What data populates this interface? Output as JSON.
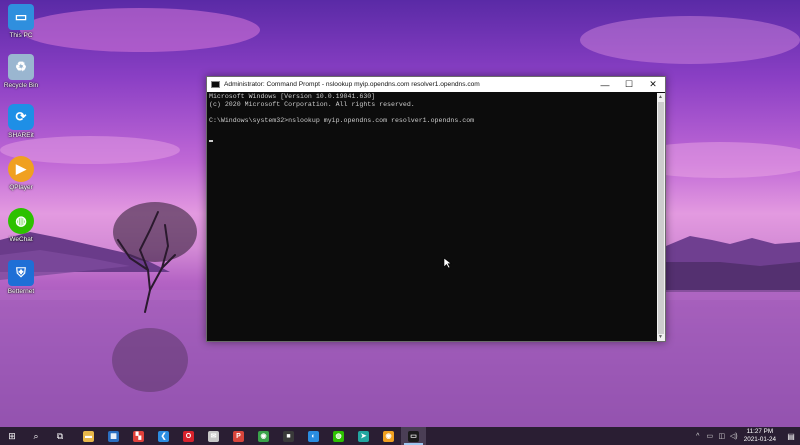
{
  "desktop": {
    "icons": [
      {
        "label": "This PC",
        "icon": "computer-icon",
        "color": "#2f8fde"
      },
      {
        "label": "Recycle Bin",
        "icon": "recycle-bin-icon",
        "color": "#9ab6d0"
      },
      {
        "label": "SHAREit",
        "icon": "shareit-icon",
        "color": "#1e8fe6"
      },
      {
        "label": "QPlayer",
        "icon": "qplayer-icon",
        "color": "#f0a020"
      },
      {
        "label": "WeChat",
        "icon": "wechat-icon",
        "color": "#2dc100"
      },
      {
        "label": "Betternet",
        "icon": "betternet-icon",
        "color": "#1f6fd6"
      }
    ]
  },
  "window": {
    "title": "Administrator: Command Prompt - nslookup  myip.opendns.com resolver1.opendns.com",
    "buttons": {
      "minimize": "—",
      "maximize": "☐",
      "close": "✕"
    },
    "console_lines": [
      "Microsoft Windows [Version 10.0.19041.630]",
      "(c) 2020 Microsoft Corporation. All rights reserved.",
      "",
      "C:\\Windows\\system32>nslookup myip.opendns.com resolver1.opendns.com"
    ]
  },
  "taskbar": {
    "start_icon": "windows-start-icon",
    "search_icon": "search-icon",
    "taskview_icon": "task-view-icon",
    "apps": [
      {
        "name": "file-explorer",
        "glyph": "▬",
        "color": "#e8b84a"
      },
      {
        "name": "microsoft-store",
        "glyph": "▦",
        "color": "#2b6fc0"
      },
      {
        "name": "color-app",
        "glyph": "▚",
        "color": "#e0403a"
      },
      {
        "name": "vs-code",
        "glyph": "❮",
        "color": "#2c8ce0"
      },
      {
        "name": "opera",
        "glyph": "O",
        "color": "#d8222c"
      },
      {
        "name": "mail",
        "glyph": "✉",
        "color": "#c8c8c8"
      },
      {
        "name": "wps-pdf",
        "glyph": "P",
        "color": "#d8453b"
      },
      {
        "name": "chrome",
        "glyph": "◉",
        "color": "#3aa34a"
      },
      {
        "name": "jetbrains",
        "glyph": "■",
        "color": "#3a3a3a"
      },
      {
        "name": "edge",
        "glyph": "◐",
        "color": "#2a8de0"
      },
      {
        "name": "wechat",
        "glyph": "◍",
        "color": "#2dc100"
      },
      {
        "name": "vs-arrow",
        "glyph": "➤",
        "color": "#22a6a0"
      },
      {
        "name": "qplayer",
        "glyph": "◉",
        "color": "#f0a020"
      },
      {
        "name": "command-prompt",
        "glyph": "▭",
        "color": "#1a1a1a"
      }
    ],
    "tray": {
      "chevron": "^",
      "battery": "▭",
      "network": "◫",
      "volume": "◁)",
      "time": "11:27 PM",
      "date": "2021-01-24",
      "notification_icon": "notification-icon"
    }
  }
}
